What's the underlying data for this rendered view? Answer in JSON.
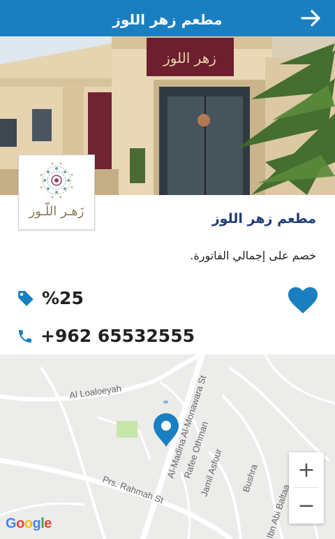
{
  "header": {
    "title": "مطعم زهر اللوز",
    "back_icon": "arrow-right-icon"
  },
  "logo": {
    "text": "زَهـر اللّـوز"
  },
  "place": {
    "name": "مطعم زهر اللوز",
    "description": "خصم على إجمالي الفاتورة.",
    "discount": "%25",
    "phone": "+962 65532555"
  },
  "icons": {
    "discount": "tag-icon",
    "phone": "phone-icon",
    "favorite": "heart-icon"
  },
  "colors": {
    "primary": "#1a7fc0",
    "title": "#1f3c78"
  },
  "map": {
    "labels": {
      "area": "Al Loaloeyah",
      "street1": "Al-Madina Al-Monawara St",
      "street2": "Rafee Othman",
      "street3": "Jamil Asfour",
      "street4": "Bushra",
      "street5": "Ibn Abi Baltaa",
      "street6": "Prs. Rahmah St"
    },
    "zoom_in": "+",
    "zoom_out": "−",
    "attribution": "Google"
  }
}
